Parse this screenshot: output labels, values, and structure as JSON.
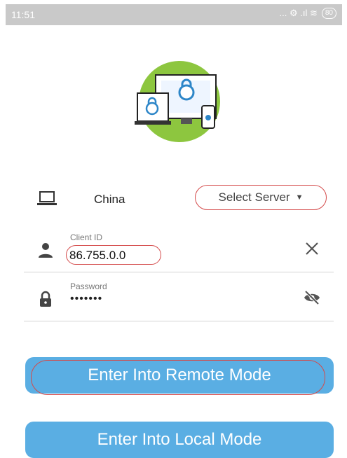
{
  "status_bar": {
    "time": "11:51",
    "icons_text": "... ⚙ .ıl ≋",
    "battery": "80"
  },
  "server": {
    "country": "China",
    "select_label": "Select Server"
  },
  "client_id": {
    "label": "Client ID",
    "value": "86.755.0.0"
  },
  "password": {
    "label": "Password",
    "value": "•••••••"
  },
  "buttons": {
    "remote_label": "Enter Into Remote Mode",
    "local_label": "Enter Into Local Mode"
  },
  "colors": {
    "button": "#5aaee3",
    "highlight": "#d44a4a",
    "logo_green": "#8dc63f"
  },
  "icons": [
    "laptop-icon",
    "person-icon",
    "lock-icon",
    "clear-icon",
    "eye-off-icon",
    "dropdown-caret-icon"
  ]
}
